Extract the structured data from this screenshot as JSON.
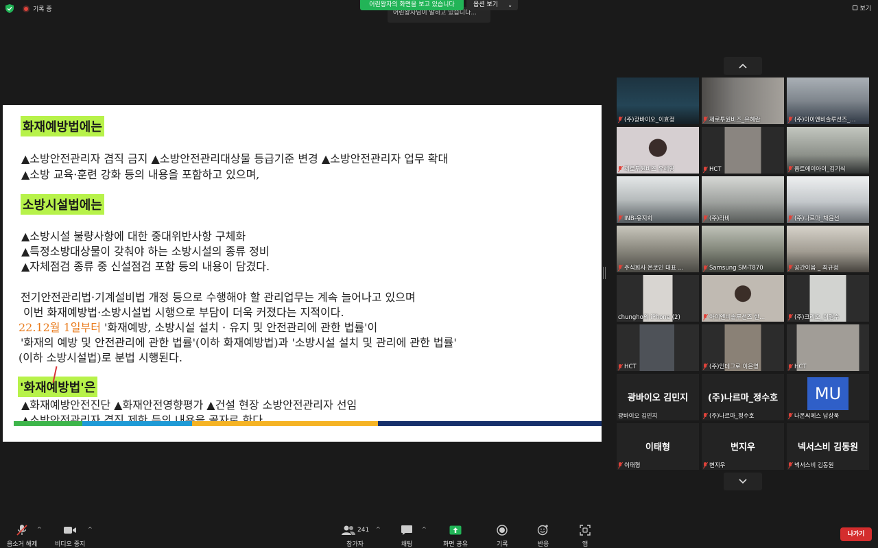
{
  "topbar": {
    "recording_label": "기록 중",
    "share_banner": "어린왕자의 화면을 보고 있습니다",
    "view_options": "옵션 보기",
    "ghost_tip": "어린왕자님이 말하고 있습니다...",
    "view_label": "보기"
  },
  "slide": {
    "heading1": "화재예방법에는",
    "p1_line1": "▲소방안전관리자 겸직 금지 ▲소방안전관리대상물 등급기준 변경 ▲소방안전관리자 업무 확대",
    "p1_line2": "▲소방 교육·훈련 강화 등의 내용을 포함하고 있으며,",
    "heading2": "소방시설법에는",
    "p2_line1": "▲소방시설 불량사항에 대한 중대위반사항 구체화",
    "p2_line2": "▲특정소방대상물이 갖춰야 하는 소방시설의 종류 정비",
    "p2_line3": "▲자체점검 종류 중 신설점검 포함 등의 내용이 담겼다.",
    "p3_line1": "전기안전관리법·기계설비법 개정 등으로 수행해야 할 관리업무는 계속 늘어나고 있으며",
    "p3_line2": "이번 화재예방법·소방시설법 시행으로 부담이 더욱 커졌다는 지적이다.",
    "p3_line3_date": "22.12월 1일부터",
    "p3_line3_rest": "'화재예방, 소방시설 설치 · 유지 및 안전관리에 관한 법률'이",
    "p3_line4": "'화재의 예방 및 안전관리에 관한 법률'(이하 화재예방법)과 '소방시설 설치 및 관리에 관한 법률'",
    "p3_line5": "(이하 소방시설법)로 분법 시행된다.",
    "heading3": "'화재예방법'은",
    "p4_line1": "▲화재예방안전진단 ▲화재안전영향평가 ▲건설 현장 소방안전관리자 선임",
    "p4_line2": "▲소방안전관리자 겸직 제한 등의 내용을 골자로 한다."
  },
  "gallery": {
    "tiles": [
      {
        "name": "(주)광바이오_이효정",
        "bg": "#1e3a4a"
      },
      {
        "name": "제로투원비즈_유혜란",
        "bg": "#6c6a68"
      },
      {
        "name": "(주)아이엔비솔루션즈_...",
        "bg": "#8a8f95"
      },
      {
        "name": "제로투원비즈 유혜영",
        "bg": "#c9c4c6"
      },
      {
        "name": "HCT",
        "bg": "#3a3a3a"
      },
      {
        "name": "옵트에이아이_김기식",
        "bg": "#9ea39c"
      },
      {
        "name": "INB-유지희",
        "bg": "#bfc4c4"
      },
      {
        "name": "(주)라비",
        "bg": "#a6a9a6"
      },
      {
        "name": "(주)나르마_채윤선",
        "bg": "#c9cdd0"
      },
      {
        "name": "주식회사 온코인 대표 ...",
        "bg": "#9a9890"
      },
      {
        "name": "Samsung SM-T870",
        "bg": "#8d9086"
      },
      {
        "name": "공간이음 _ 최규정",
        "bg": "#b9b5ad"
      },
      {
        "name": "chungho의 iPhone (2)",
        "bg": "#d1ceca"
      },
      {
        "name": "아이엔비솔루션즈 한...",
        "bg": "#b2aca4"
      },
      {
        "name": "(주)크리오_이경수",
        "bg": "#c8c9c6"
      },
      {
        "name": "HCT",
        "bg": "#3b3e42"
      },
      {
        "name": "(주)인테그로 이은영",
        "bg": "#7a736a"
      },
      {
        "name": "HCT",
        "bg": "#8e8b86"
      }
    ],
    "text_tiles": [
      {
        "display": "광바이오 김민지",
        "name": "광바이오 김민지"
      },
      {
        "display": "(주)나르마_정수호",
        "name": "(주)나르마_정수호"
      },
      {
        "display": "MU",
        "name": "나온씨에스 남상욱"
      },
      {
        "display": "이태형",
        "name": "이태형"
      },
      {
        "display": "변지우",
        "name": "변지우"
      },
      {
        "display": "넥서스비 김동원",
        "name": "넥서스비 김동원"
      }
    ]
  },
  "toolbar": {
    "mute_label": "음소거 해제",
    "video_label": "비디오 중지",
    "participants_count": "241",
    "participants_label": "참가자",
    "chat_label": "채팅",
    "share_label": "화면 공유",
    "record_label": "기록",
    "reactions_label": "반응",
    "apps_label": "앱",
    "leave_label": "나가기"
  },
  "colors": {
    "highlight": "#b7f24a",
    "share_green": "#22b457",
    "leave_red": "#d42d2d",
    "bar_green": "#3db54a",
    "bar_blue": "#1e9ad6",
    "bar_yellow": "#f5b324",
    "bar_navy": "#16306b"
  }
}
